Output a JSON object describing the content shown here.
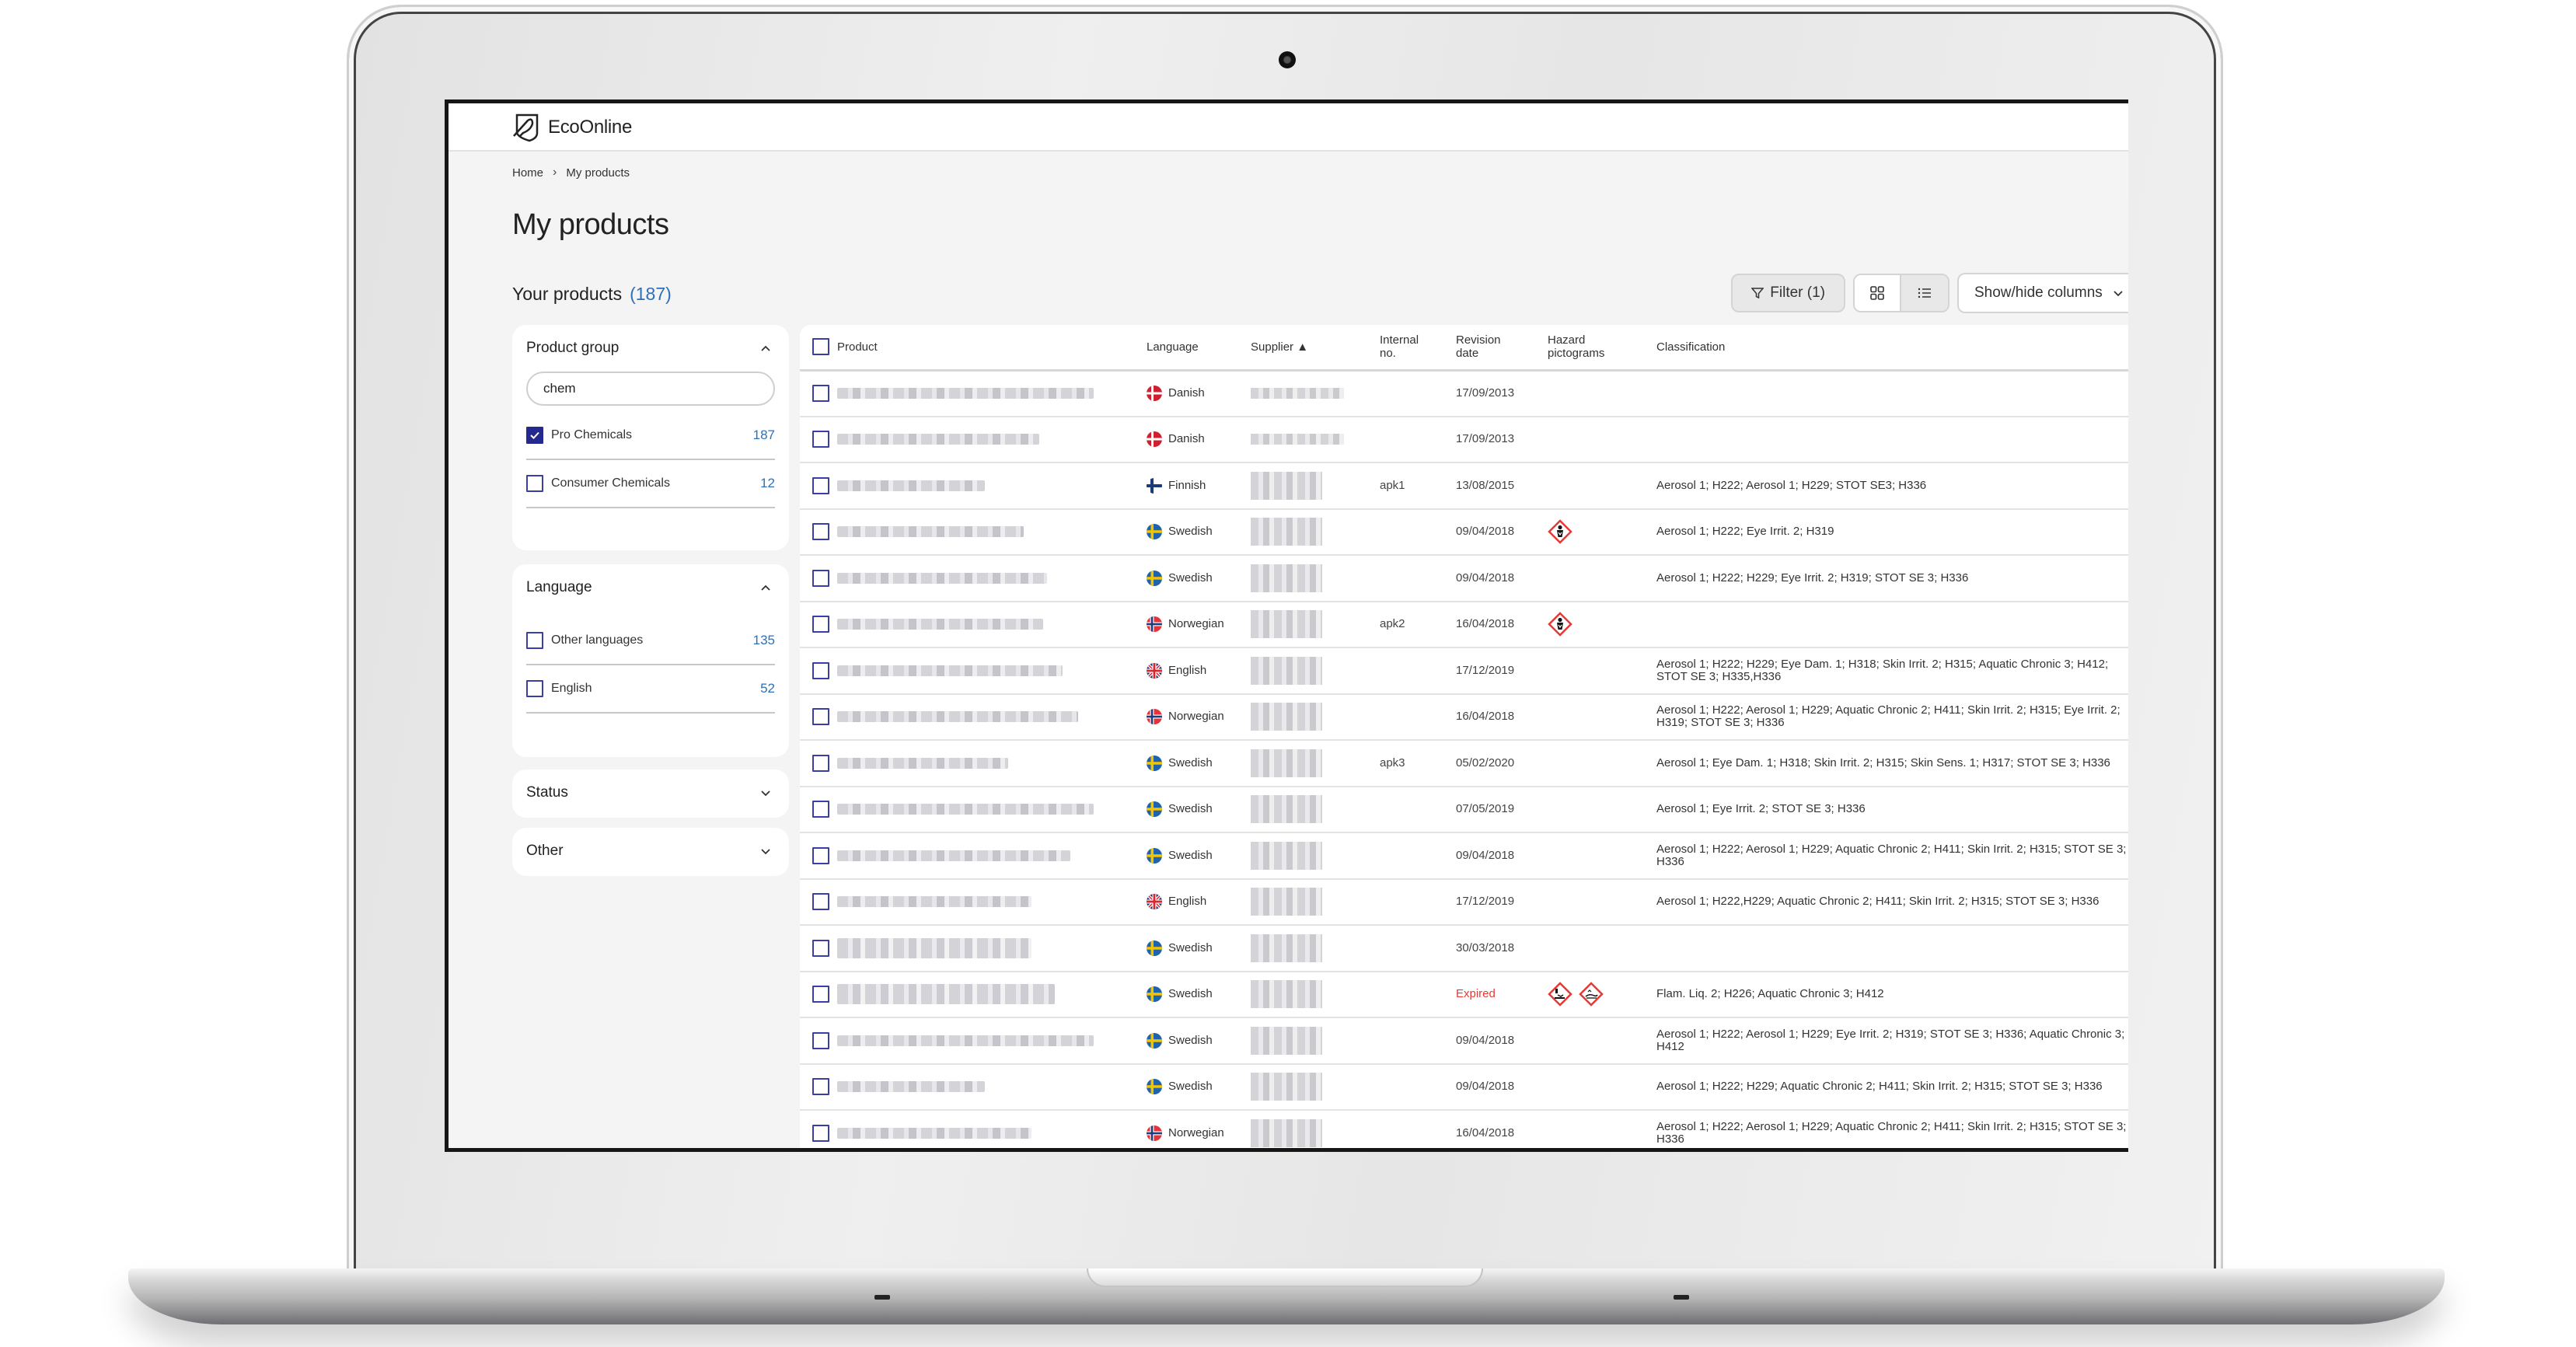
{
  "app": {
    "brand": "EcoOnline"
  },
  "breadcrumb": {
    "home": "Home",
    "current": "My products"
  },
  "page": {
    "title": "My products",
    "subtitle": "Your products",
    "count": "(187)"
  },
  "toolbar": {
    "filter_label": "Filter (1)",
    "grid_view_icon": "grid-icon",
    "list_view_icon": "list-icon",
    "columns_label": "Show/hide columns"
  },
  "sidebar": {
    "product_group": {
      "title": "Product group",
      "search_value": "chem",
      "options": [
        {
          "label": "Pro Chemicals",
          "count": "187",
          "checked": true
        },
        {
          "label": "Consumer Chemicals",
          "count": "12",
          "checked": false
        }
      ]
    },
    "language": {
      "title": "Language",
      "options": [
        {
          "label": "Other languages",
          "count": "135",
          "checked": false
        },
        {
          "label": "English",
          "count": "52",
          "checked": false
        }
      ]
    },
    "status": {
      "title": "Status"
    },
    "other": {
      "title": "Other"
    }
  },
  "table": {
    "headers": {
      "product": "Product",
      "language": "Language",
      "supplier": "Supplier ▲",
      "internal_no_1": "Internal",
      "internal_no_2": "no.",
      "revision_1": "Revision",
      "revision_2": "date",
      "hazard_1": "Hazard",
      "hazard_2": "pictograms",
      "classification": "Classification"
    },
    "rows": [
      {
        "language": "Danish",
        "flag": "dk",
        "internal_no": "",
        "revision": "17/09/2013",
        "pictograms": [],
        "classification": ""
      },
      {
        "language": "Danish",
        "flag": "dk",
        "internal_no": "",
        "revision": "17/09/2013",
        "pictograms": [],
        "classification": ""
      },
      {
        "language": "Finnish",
        "flag": "fi",
        "internal_no": "apk1",
        "revision": "13/08/2015",
        "pictograms": [],
        "classification": "Aerosol 1; H222; Aerosol 1; H229; STOT SE3; H336"
      },
      {
        "language": "Swedish",
        "flag": "se",
        "internal_no": "",
        "revision": "09/04/2018",
        "pictograms": [
          "health-hazard"
        ],
        "classification": "Aerosol 1; H222; Eye Irrit. 2; H319"
      },
      {
        "language": "Swedish",
        "flag": "se",
        "internal_no": "",
        "revision": "09/04/2018",
        "pictograms": [],
        "classification": "Aerosol 1; H222; H229; Eye Irrit. 2; H319; STOT SE 3; H336"
      },
      {
        "language": "Norwegian",
        "flag": "no",
        "internal_no": "apk2",
        "revision": "16/04/2018",
        "pictograms": [
          "health-hazard"
        ],
        "classification": ""
      },
      {
        "language": "English",
        "flag": "gb",
        "internal_no": "",
        "revision": "17/12/2019",
        "pictograms": [],
        "classification": "Aerosol 1; H222; H229; Eye Dam. 1; H318; Skin Irrit. 2; H315; Aquatic Chronic 3; H412; STOT SE 3; H335,H336"
      },
      {
        "language": "Norwegian",
        "flag": "no",
        "internal_no": "",
        "revision": "16/04/2018",
        "pictograms": [],
        "classification": "Aerosol 1; H222; Aerosol 1; H229; Aquatic Chronic 2; H411; Skin Irrit. 2; H315; Eye Irrit. 2; H319; STOT SE 3; H336"
      },
      {
        "language": "Swedish",
        "flag": "se",
        "internal_no": "apk3",
        "revision": "05/02/2020",
        "pictograms": [],
        "classification": "Aerosol 1; Eye Dam. 1; H318; Skin Irrit. 2; H315; Skin Sens. 1; H317; STOT SE 3; H336"
      },
      {
        "language": "Swedish",
        "flag": "se",
        "internal_no": "",
        "revision": "07/05/2019",
        "pictograms": [],
        "classification": "Aerosol 1; Eye Irrit. 2; STOT SE 3; H336"
      },
      {
        "language": "Swedish",
        "flag": "se",
        "internal_no": "",
        "revision": "09/04/2018",
        "pictograms": [],
        "classification": "Aerosol 1; H222; Aerosol 1; H229; Aquatic Chronic 2; H411; Skin Irrit. 2; H315; STOT SE 3; H336"
      },
      {
        "language": "English",
        "flag": "gb",
        "internal_no": "",
        "revision": "17/12/2019",
        "pictograms": [],
        "classification": "Aerosol 1; H222,H229; Aquatic Chronic 2; H411; Skin Irrit. 2; H315; STOT SE 3; H336"
      },
      {
        "language": "Swedish",
        "flag": "se",
        "internal_no": "",
        "revision": "30/03/2018",
        "pictograms": [],
        "classification": ""
      },
      {
        "language": "Swedish",
        "flag": "se",
        "internal_no": "",
        "revision": "Expired",
        "expired": true,
        "pictograms": [
          "corrosive",
          "environment"
        ],
        "classification": "Flam. Liq. 2; H226; Aquatic Chronic 3; H412"
      },
      {
        "language": "Swedish",
        "flag": "se",
        "internal_no": "",
        "revision": "09/04/2018",
        "pictograms": [],
        "classification": "Aerosol 1; H222; Aerosol 1; H229; Eye Irrit. 2; H319; STOT SE 3; H336; Aquatic Chronic 3; H412"
      },
      {
        "language": "Swedish",
        "flag": "se",
        "internal_no": "",
        "revision": "09/04/2018",
        "pictograms": [],
        "classification": "Aerosol 1; H222; H229; Aquatic Chronic 2; H411; Skin Irrit. 2; H315; STOT SE 3; H336"
      },
      {
        "language": "Norwegian",
        "flag": "no",
        "internal_no": "",
        "revision": "16/04/2018",
        "pictograms": [],
        "classification": "Aerosol 1; H222; Aerosol 1; H229; Aquatic Chronic 2; H411; Skin Irrit. 2; H315; STOT SE 3; H336"
      }
    ]
  },
  "colors": {
    "accent": "#2f6fb5",
    "checkbox": "#25298f",
    "expired": "#e53935",
    "hazard": "#e53935"
  }
}
